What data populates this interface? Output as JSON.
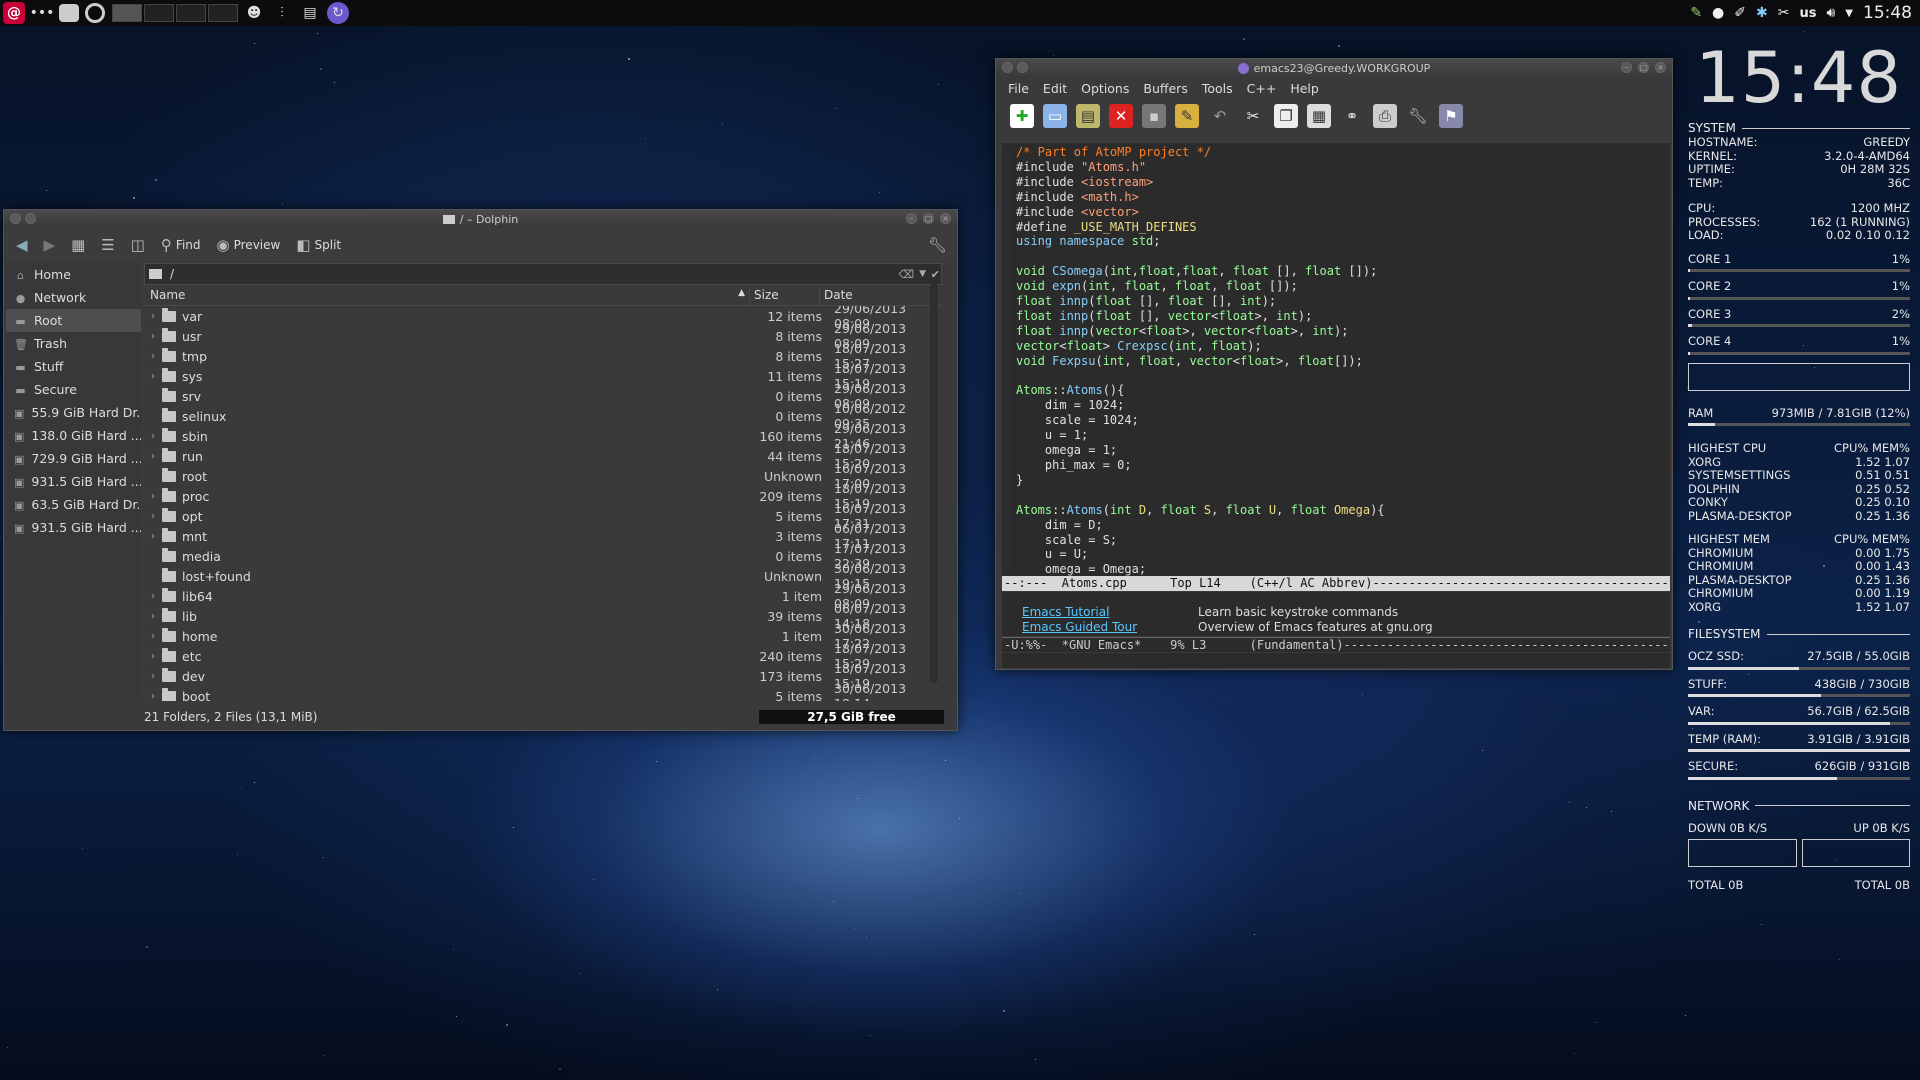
{
  "panel": {
    "clock": "15:48",
    "layout": "us"
  },
  "dolphin": {
    "title": "/ – Dolphin",
    "toolbar": {
      "find": "Find",
      "preview": "Preview",
      "split": "Split"
    },
    "places": [
      {
        "label": "Home",
        "icon": "home-icon"
      },
      {
        "label": "Network",
        "icon": "network-icon"
      },
      {
        "label": "Root",
        "icon": "folder-icon",
        "selected": true
      },
      {
        "label": "Trash",
        "icon": "trash-icon"
      },
      {
        "label": "Stuff",
        "icon": "folder-icon"
      },
      {
        "label": "Secure",
        "icon": "folder-icon"
      },
      {
        "label": "55.9 GiB Hard Dr...",
        "icon": "drive-icon"
      },
      {
        "label": "138.0 GiB Hard ...",
        "icon": "drive-icon"
      },
      {
        "label": "729.9 GiB Hard ...",
        "icon": "drive-icon"
      },
      {
        "label": "931.5 GiB Hard ...",
        "icon": "drive-icon"
      },
      {
        "label": "63.5 GiB Hard Dr...",
        "icon": "drive-icon"
      },
      {
        "label": "931.5 GiB Hard ...",
        "icon": "drive-icon"
      }
    ],
    "location": "/",
    "columns": {
      "name": "Name",
      "size": "Size",
      "date": "Date"
    },
    "files": [
      {
        "name": "var",
        "size": "12 items",
        "date": "29/06/2013 08:09",
        "expandable": true
      },
      {
        "name": "usr",
        "size": "8 items",
        "date": "29/06/2013 08:09",
        "expandable": true
      },
      {
        "name": "tmp",
        "size": "8 items",
        "date": "18/07/2013 15:27",
        "expandable": true
      },
      {
        "name": "sys",
        "size": "11 items",
        "date": "18/07/2013 15:19",
        "expandable": true
      },
      {
        "name": "srv",
        "size": "0 items",
        "date": "29/06/2013 08:09",
        "expandable": false
      },
      {
        "name": "selinux",
        "size": "0 items",
        "date": "10/06/2012 09:35",
        "expandable": false
      },
      {
        "name": "sbin",
        "size": "160 items",
        "date": "29/06/2013 21:46",
        "expandable": true
      },
      {
        "name": "run",
        "size": "44 items",
        "date": "18/07/2013 15:20",
        "expandable": true
      },
      {
        "name": "root",
        "size": "Unknown",
        "date": "16/07/2013 17:00",
        "expandable": false
      },
      {
        "name": "proc",
        "size": "209 items",
        "date": "18/07/2013 15:19",
        "expandable": true
      },
      {
        "name": "opt",
        "size": "5 items",
        "date": "16/07/2013 17:31",
        "expandable": true
      },
      {
        "name": "mnt",
        "size": "3 items",
        "date": "06/07/2013 17:11",
        "expandable": true
      },
      {
        "name": "media",
        "size": "0 items",
        "date": "17/07/2013 22:39",
        "expandable": false
      },
      {
        "name": "lost+found",
        "size": "Unknown",
        "date": "30/06/2013 19:15",
        "expandable": false
      },
      {
        "name": "lib64",
        "size": "1 item",
        "date": "29/06/2013 08:09",
        "expandable": true
      },
      {
        "name": "lib",
        "size": "39 items",
        "date": "06/07/2013 14:18",
        "expandable": true
      },
      {
        "name": "home",
        "size": "1 item",
        "date": "30/06/2013 17:22",
        "expandable": true
      },
      {
        "name": "etc",
        "size": "240 items",
        "date": "18/07/2013 15:29",
        "expandable": true
      },
      {
        "name": "dev",
        "size": "173 items",
        "date": "18/07/2013 15:19",
        "expandable": true
      },
      {
        "name": "boot",
        "size": "5 items",
        "date": "30/06/2013 18:14",
        "expandable": true
      }
    ],
    "status": "21 Folders, 2 Files (13,1 MiB)",
    "free": "27,5 GiB free"
  },
  "emacs": {
    "title": "emacs23@Greedy.WORKGROUP",
    "menu": [
      "File",
      "Edit",
      "Options",
      "Buffers",
      "Tools",
      "C++",
      "Help"
    ],
    "toolbar_icons": [
      "new-file-icon",
      "open-folder-icon",
      "dired-icon",
      "close-buffer-icon",
      "save-icon",
      "save-as-icon",
      "undo-icon",
      "cut-icon",
      "copy-icon",
      "paste-icon",
      "search-icon",
      "print-icon",
      "preferences-icon",
      "help-icon"
    ],
    "code": [
      [
        [
          "cm",
          "/* Part of AtoMP project */"
        ]
      ],
      [
        [
          "pp",
          "#include "
        ],
        [
          "str",
          "\"Atoms.h\""
        ]
      ],
      [
        [
          "pp",
          "#include "
        ],
        [
          "str",
          "<iostream>"
        ]
      ],
      [
        [
          "pp",
          "#include "
        ],
        [
          "str",
          "<math.h>"
        ]
      ],
      [
        [
          "pp",
          "#include "
        ],
        [
          "str",
          "<vector>"
        ]
      ],
      [
        [
          "pp",
          "#define "
        ],
        [
          "vr",
          "_USE_MATH_DEFINES"
        ]
      ],
      [
        [
          "kw",
          "using namespace "
        ],
        [
          "ty",
          "std"
        ],
        [
          "tx",
          ";"
        ]
      ],
      [
        [
          "tx",
          ""
        ]
      ],
      [
        [
          "ty",
          "void "
        ],
        [
          "fn",
          "CSomega"
        ],
        [
          "tx",
          "("
        ],
        [
          "ty",
          "int"
        ],
        [
          "tx",
          ","
        ],
        [
          "ty",
          "float"
        ],
        [
          "tx",
          ","
        ],
        [
          "ty",
          "float"
        ],
        [
          "tx",
          ", "
        ],
        [
          "ty",
          "float"
        ],
        [
          "tx",
          " [], "
        ],
        [
          "ty",
          "float"
        ],
        [
          "tx",
          " []);"
        ]
      ],
      [
        [
          "ty",
          "void "
        ],
        [
          "fn",
          "expn"
        ],
        [
          "tx",
          "("
        ],
        [
          "ty",
          "int"
        ],
        [
          "tx",
          ", "
        ],
        [
          "ty",
          "float"
        ],
        [
          "tx",
          ", "
        ],
        [
          "ty",
          "float"
        ],
        [
          "tx",
          ", "
        ],
        [
          "ty",
          "float"
        ],
        [
          "tx",
          " []);"
        ]
      ],
      [
        [
          "ty",
          "float "
        ],
        [
          "fn",
          "innp"
        ],
        [
          "tx",
          "("
        ],
        [
          "ty",
          "float"
        ],
        [
          "tx",
          " [], "
        ],
        [
          "ty",
          "float"
        ],
        [
          "tx",
          " [], "
        ],
        [
          "ty",
          "int"
        ],
        [
          "tx",
          ");"
        ]
      ],
      [
        [
          "ty",
          "float "
        ],
        [
          "fn",
          "innp"
        ],
        [
          "tx",
          "("
        ],
        [
          "ty",
          "float"
        ],
        [
          "tx",
          " [], "
        ],
        [
          "ty",
          "vector"
        ],
        [
          "tx",
          "<"
        ],
        [
          "ty",
          "float"
        ],
        [
          "tx",
          ">, "
        ],
        [
          "ty",
          "int"
        ],
        [
          "tx",
          ");"
        ]
      ],
      [
        [
          "ty",
          "float "
        ],
        [
          "fn",
          "innp"
        ],
        [
          "tx",
          "("
        ],
        [
          "ty",
          "vector"
        ],
        [
          "tx",
          "<"
        ],
        [
          "ty",
          "float"
        ],
        [
          "tx",
          ">, "
        ],
        [
          "ty",
          "vector"
        ],
        [
          "tx",
          "<"
        ],
        [
          "ty",
          "float"
        ],
        [
          "tx",
          ">, "
        ],
        [
          "ty",
          "int"
        ],
        [
          "tx",
          ");"
        ]
      ],
      [
        [
          "ty",
          "vector"
        ],
        [
          "tx",
          "<"
        ],
        [
          "ty",
          "float"
        ],
        [
          "tx",
          "> "
        ],
        [
          "fn",
          "Crexpsc"
        ],
        [
          "tx",
          "("
        ],
        [
          "ty",
          "int"
        ],
        [
          "tx",
          ", "
        ],
        [
          "ty",
          "float"
        ],
        [
          "tx",
          ");"
        ]
      ],
      [
        [
          "ty",
          "void "
        ],
        [
          "fn",
          "Fexpsu"
        ],
        [
          "tx",
          "("
        ],
        [
          "ty",
          "int"
        ],
        [
          "tx",
          ", "
        ],
        [
          "ty",
          "float"
        ],
        [
          "tx",
          ", "
        ],
        [
          "ty",
          "vector"
        ],
        [
          "tx",
          "<"
        ],
        [
          "ty",
          "float"
        ],
        [
          "tx",
          ">, "
        ],
        [
          "ty",
          "float"
        ],
        [
          "tx",
          "[]);"
        ]
      ],
      [
        [
          "tx",
          ""
        ]
      ],
      [
        [
          "ty",
          "Atoms"
        ],
        [
          "tx",
          "::"
        ],
        [
          "fn",
          "Atoms"
        ],
        [
          "tx",
          "(){"
        ]
      ],
      [
        [
          "tx",
          "    dim = 1024;"
        ]
      ],
      [
        [
          "tx",
          "    scale = 1024;"
        ]
      ],
      [
        [
          "tx",
          "    u = 1;"
        ]
      ],
      [
        [
          "tx",
          "    omega = 1;"
        ]
      ],
      [
        [
          "tx",
          "    phi_max = 0;"
        ]
      ],
      [
        [
          "tx",
          "}"
        ]
      ],
      [
        [
          "tx",
          ""
        ]
      ],
      [
        [
          "ty",
          "Atoms"
        ],
        [
          "tx",
          "::"
        ],
        [
          "fn",
          "Atoms"
        ],
        [
          "tx",
          "("
        ],
        [
          "ty",
          "int"
        ],
        [
          "vr",
          " D"
        ],
        [
          "tx",
          ", "
        ],
        [
          "ty",
          "float"
        ],
        [
          "vr",
          " S"
        ],
        [
          "tx",
          ", "
        ],
        [
          "ty",
          "float"
        ],
        [
          "vr",
          " U"
        ],
        [
          "tx",
          ", "
        ],
        [
          "ty",
          "float"
        ],
        [
          "vr",
          " Omega"
        ],
        [
          "tx",
          "){"
        ]
      ],
      [
        [
          "tx",
          "    dim = D;"
        ]
      ],
      [
        [
          "tx",
          "    scale = S;"
        ]
      ],
      [
        [
          "tx",
          "    u = U;"
        ]
      ],
      [
        [
          "tx",
          "    omega = Omega;"
        ]
      ]
    ],
    "modeline1": "--:---  Atoms.cpp      Top L14    (C++/l AC Abbrev)------------------------------------------------------------",
    "help": [
      {
        "link": "Emacs Tutorial",
        "desc": "Learn basic keystroke commands"
      },
      {
        "link": "Emacs Guided Tour",
        "desc": "Overview of Emacs features at gnu.org"
      }
    ],
    "modeline2": "-U:%%-  *GNU Emacs*    9% L3      (Fundamental)-----------------------------------------------------------------"
  },
  "conky": {
    "clock": "15:48",
    "system_label": "SYSTEM",
    "system": [
      {
        "k": "HOSTNAME:",
        "v": "GREEDY"
      },
      {
        "k": "KERNEL:",
        "v": "3.2.0-4-AMD64"
      },
      {
        "k": "UPTIME:",
        "v": "0H 28M 32S"
      },
      {
        "k": "TEMP:",
        "v": "36C"
      }
    ],
    "cpu": [
      {
        "k": "CPU:",
        "v": "1200 MHZ"
      },
      {
        "k": "PROCESSES:",
        "v": "162 (1 RUNNING)"
      },
      {
        "k": "LOAD:",
        "v": "0.02 0.10 0.12"
      }
    ],
    "cores": [
      {
        "k": "CORE 1",
        "v": "1%",
        "pct": 0.01
      },
      {
        "k": "CORE 2",
        "v": "1%",
        "pct": 0.01
      },
      {
        "k": "CORE 3",
        "v": "2%",
        "pct": 0.02
      },
      {
        "k": "CORE 4",
        "v": "1%",
        "pct": 0.01
      }
    ],
    "ram": {
      "k": "RAM",
      "v": "973MIB / 7.81GIB (12%)",
      "pct": 0.12
    },
    "highest_cpu": {
      "header_k": "HIGHEST CPU",
      "header_v": "CPU% MEM%",
      "rows": [
        {
          "k": "XORG",
          "v": "1.52  1.07"
        },
        {
          "k": "SYSTEMSETTINGS",
          "v": "0.51  0.51"
        },
        {
          "k": "DOLPHIN",
          "v": "0.25  0.52"
        },
        {
          "k": "CONKY",
          "v": "0.25  0.10"
        },
        {
          "k": "PLASMA-DESKTOP",
          "v": "0.25  1.36"
        }
      ]
    },
    "highest_mem": {
      "header_k": "HIGHEST MEM",
      "header_v": "CPU% MEM%",
      "rows": [
        {
          "k": "CHROMIUM",
          "v": "0.00  1.75"
        },
        {
          "k": "CHROMIUM",
          "v": "0.00  1.43"
        },
        {
          "k": "PLASMA-DESKTOP",
          "v": "0.25  1.36"
        },
        {
          "k": "CHROMIUM",
          "v": "0.00  1.19"
        },
        {
          "k": "XORG",
          "v": "1.52  1.07"
        }
      ]
    },
    "fs_label": "FILESYSTEM",
    "filesystem": [
      {
        "k": "OCZ SSD:",
        "v": "27.5GIB / 55.0GIB",
        "pct": 0.5
      },
      {
        "k": "STUFF:",
        "v": "438GIB / 730GIB",
        "pct": 0.6
      },
      {
        "k": "VAR:",
        "v": "56.7GIB / 62.5GIB",
        "pct": 0.91
      },
      {
        "k": "TEMP (RAM):",
        "v": "3.91GIB / 3.91GIB",
        "pct": 1.0
      },
      {
        "k": "SECURE:",
        "v": "626GIB / 931GIB",
        "pct": 0.67
      }
    ],
    "net_label": "NETWORK",
    "down": "DOWN 0B  K/S",
    "up": "UP 0B  K/S",
    "total_down": "TOTAL 0B",
    "total_up": "TOTAL 0B"
  }
}
